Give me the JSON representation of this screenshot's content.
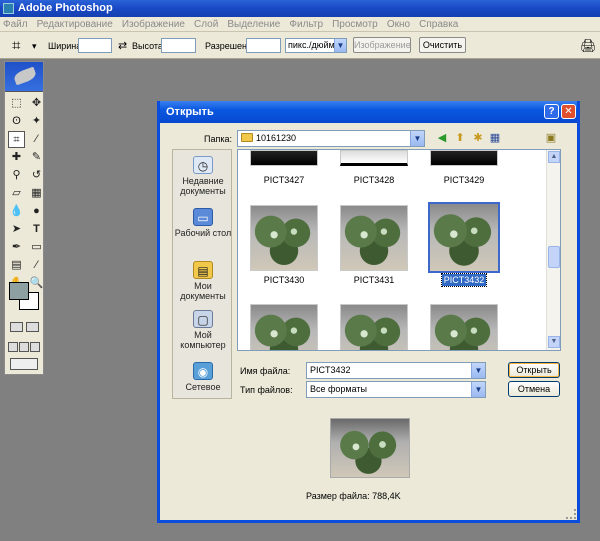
{
  "app": {
    "title": "Adobe Photoshop",
    "menu": [
      "Файл",
      "Редактирование",
      "Изображение",
      "Слой",
      "Выделение",
      "Фильтр",
      "Просмотр",
      "Окно",
      "Справка"
    ]
  },
  "options_bar": {
    "width_label": "Ширина:",
    "width_value": "",
    "height_label": "Высота:",
    "height_value": "",
    "resolution_label": "Разрешение:",
    "resolution_value": "",
    "units": "пикс./дюйм",
    "image_button": "Изображение",
    "clear_button": "Очистить"
  },
  "dialog": {
    "title": "Открыть",
    "folder_label": "Папка:",
    "folder_value": "10161230",
    "places": [
      {
        "label": "Недавние документы",
        "icon": "recent-icon"
      },
      {
        "label": "Рабочий стол",
        "icon": "desktop-icon"
      },
      {
        "label": "Мои документы",
        "icon": "my-documents-icon"
      },
      {
        "label": "Мой компьютер",
        "icon": "my-computer-icon"
      },
      {
        "label": "Сетевое",
        "icon": "network-icon"
      }
    ],
    "files": [
      "PICT3427",
      "PICT3428",
      "PICT3429",
      "PICT3430",
      "PICT3431",
      "PICT3432"
    ],
    "selected_file": "PICT3432",
    "filename_label": "Имя файла:",
    "filename_value": "PICT3432",
    "filetype_label": "Тип файлов:",
    "filetype_value": "Все форматы",
    "open_button": "Открыть",
    "cancel_button": "Отмена",
    "filesize_text": "Размер файла: 788,4K",
    "help_glyph": "?",
    "close_glyph": "✕"
  }
}
